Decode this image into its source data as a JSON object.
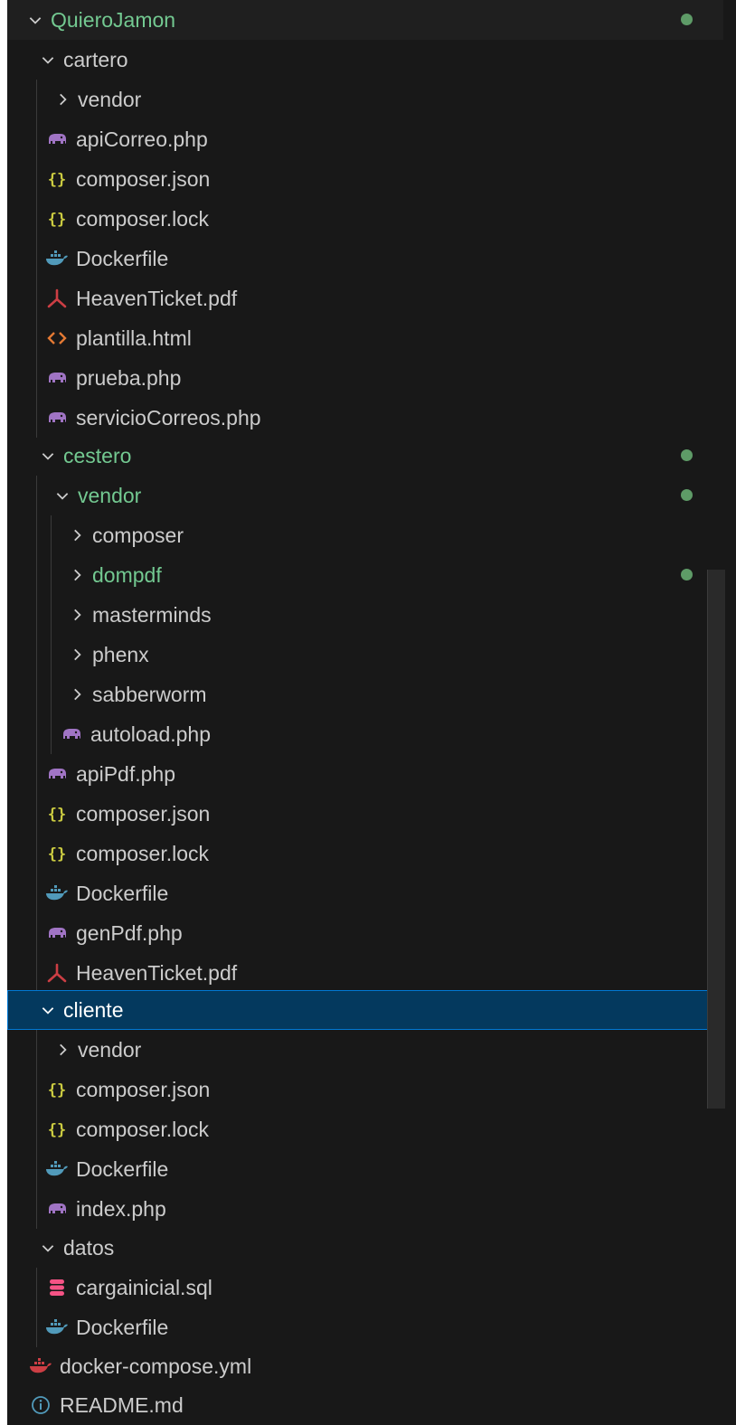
{
  "explorer": {
    "root": {
      "label": "QuieroJamon"
    },
    "cartero": {
      "label": "cartero",
      "vendor": "vendor",
      "files": [
        "apiCorreo.php",
        "composer.json",
        "composer.lock",
        "Dockerfile",
        "HeavenTicket.pdf",
        "plantilla.html",
        "prueba.php",
        "servicioCorreos.php"
      ]
    },
    "cestero": {
      "label": "cestero",
      "vendor": {
        "label": "vendor",
        "folders": [
          "composer",
          "dompdf",
          "masterminds",
          "phenx",
          "sabberworm"
        ],
        "autoload": "autoload.php"
      },
      "files": [
        "apiPdf.php",
        "composer.json",
        "composer.lock",
        "Dockerfile",
        "genPdf.php",
        "HeavenTicket.pdf"
      ]
    },
    "cliente": {
      "label": "cliente",
      "vendor": "vendor",
      "files": [
        "composer.json",
        "composer.lock",
        "Dockerfile",
        "index.php"
      ]
    },
    "datos": {
      "label": "datos",
      "files": [
        "cargainicial.sql",
        "Dockerfile"
      ]
    },
    "root_files": [
      "docker-compose.yml",
      "README.md"
    ]
  },
  "icons": {
    "php": "elephant-icon",
    "json": "braces-icon",
    "docker": "docker-whale-icon",
    "pdf": "pdf-icon",
    "html": "code-brackets-icon",
    "sql": "database-icon",
    "info": "info-icon"
  },
  "colors": {
    "background": "#181818",
    "text": "#cccccc",
    "modified": "#73c991",
    "selected_bg": "#04395e",
    "selected_border": "#0078d4",
    "php": "#a074c4",
    "json": "#cbcb41",
    "docker": "#519aba",
    "pdf": "#cc3e44",
    "html": "#e37933",
    "sql": "#f55385",
    "info": "#519aba"
  }
}
